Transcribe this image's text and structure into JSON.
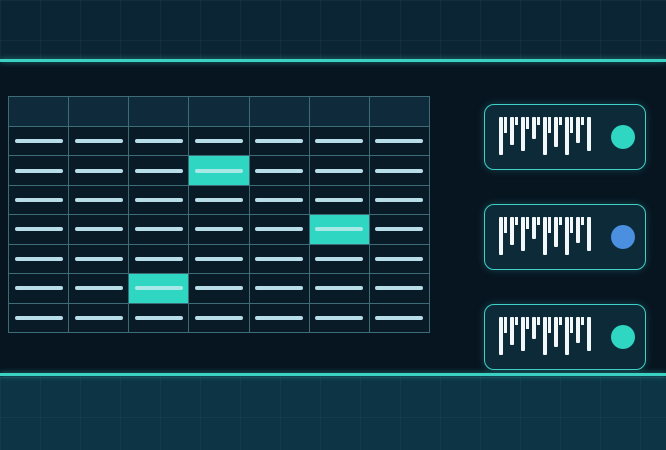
{
  "colors": {
    "accent": "#3bd1c3",
    "highlight_cell": "#2fd6c2",
    "bar": "#b6dde8",
    "dot_teal": "#2fd6c2",
    "dot_blue": "#4a8fe0"
  },
  "table": {
    "columns": 7,
    "rows": 7,
    "highlighted_cells": [
      {
        "row": 1,
        "col": 3
      },
      {
        "row": 3,
        "col": 5
      },
      {
        "row": 5,
        "col": 2
      }
    ]
  },
  "cards": [
    {
      "icon": "barcode-icon",
      "status_color": "#2fd6c2"
    },
    {
      "icon": "barcode-icon",
      "status_color": "#4a8fe0"
    },
    {
      "icon": "barcode-icon",
      "status_color": "#2fd6c2"
    }
  ]
}
